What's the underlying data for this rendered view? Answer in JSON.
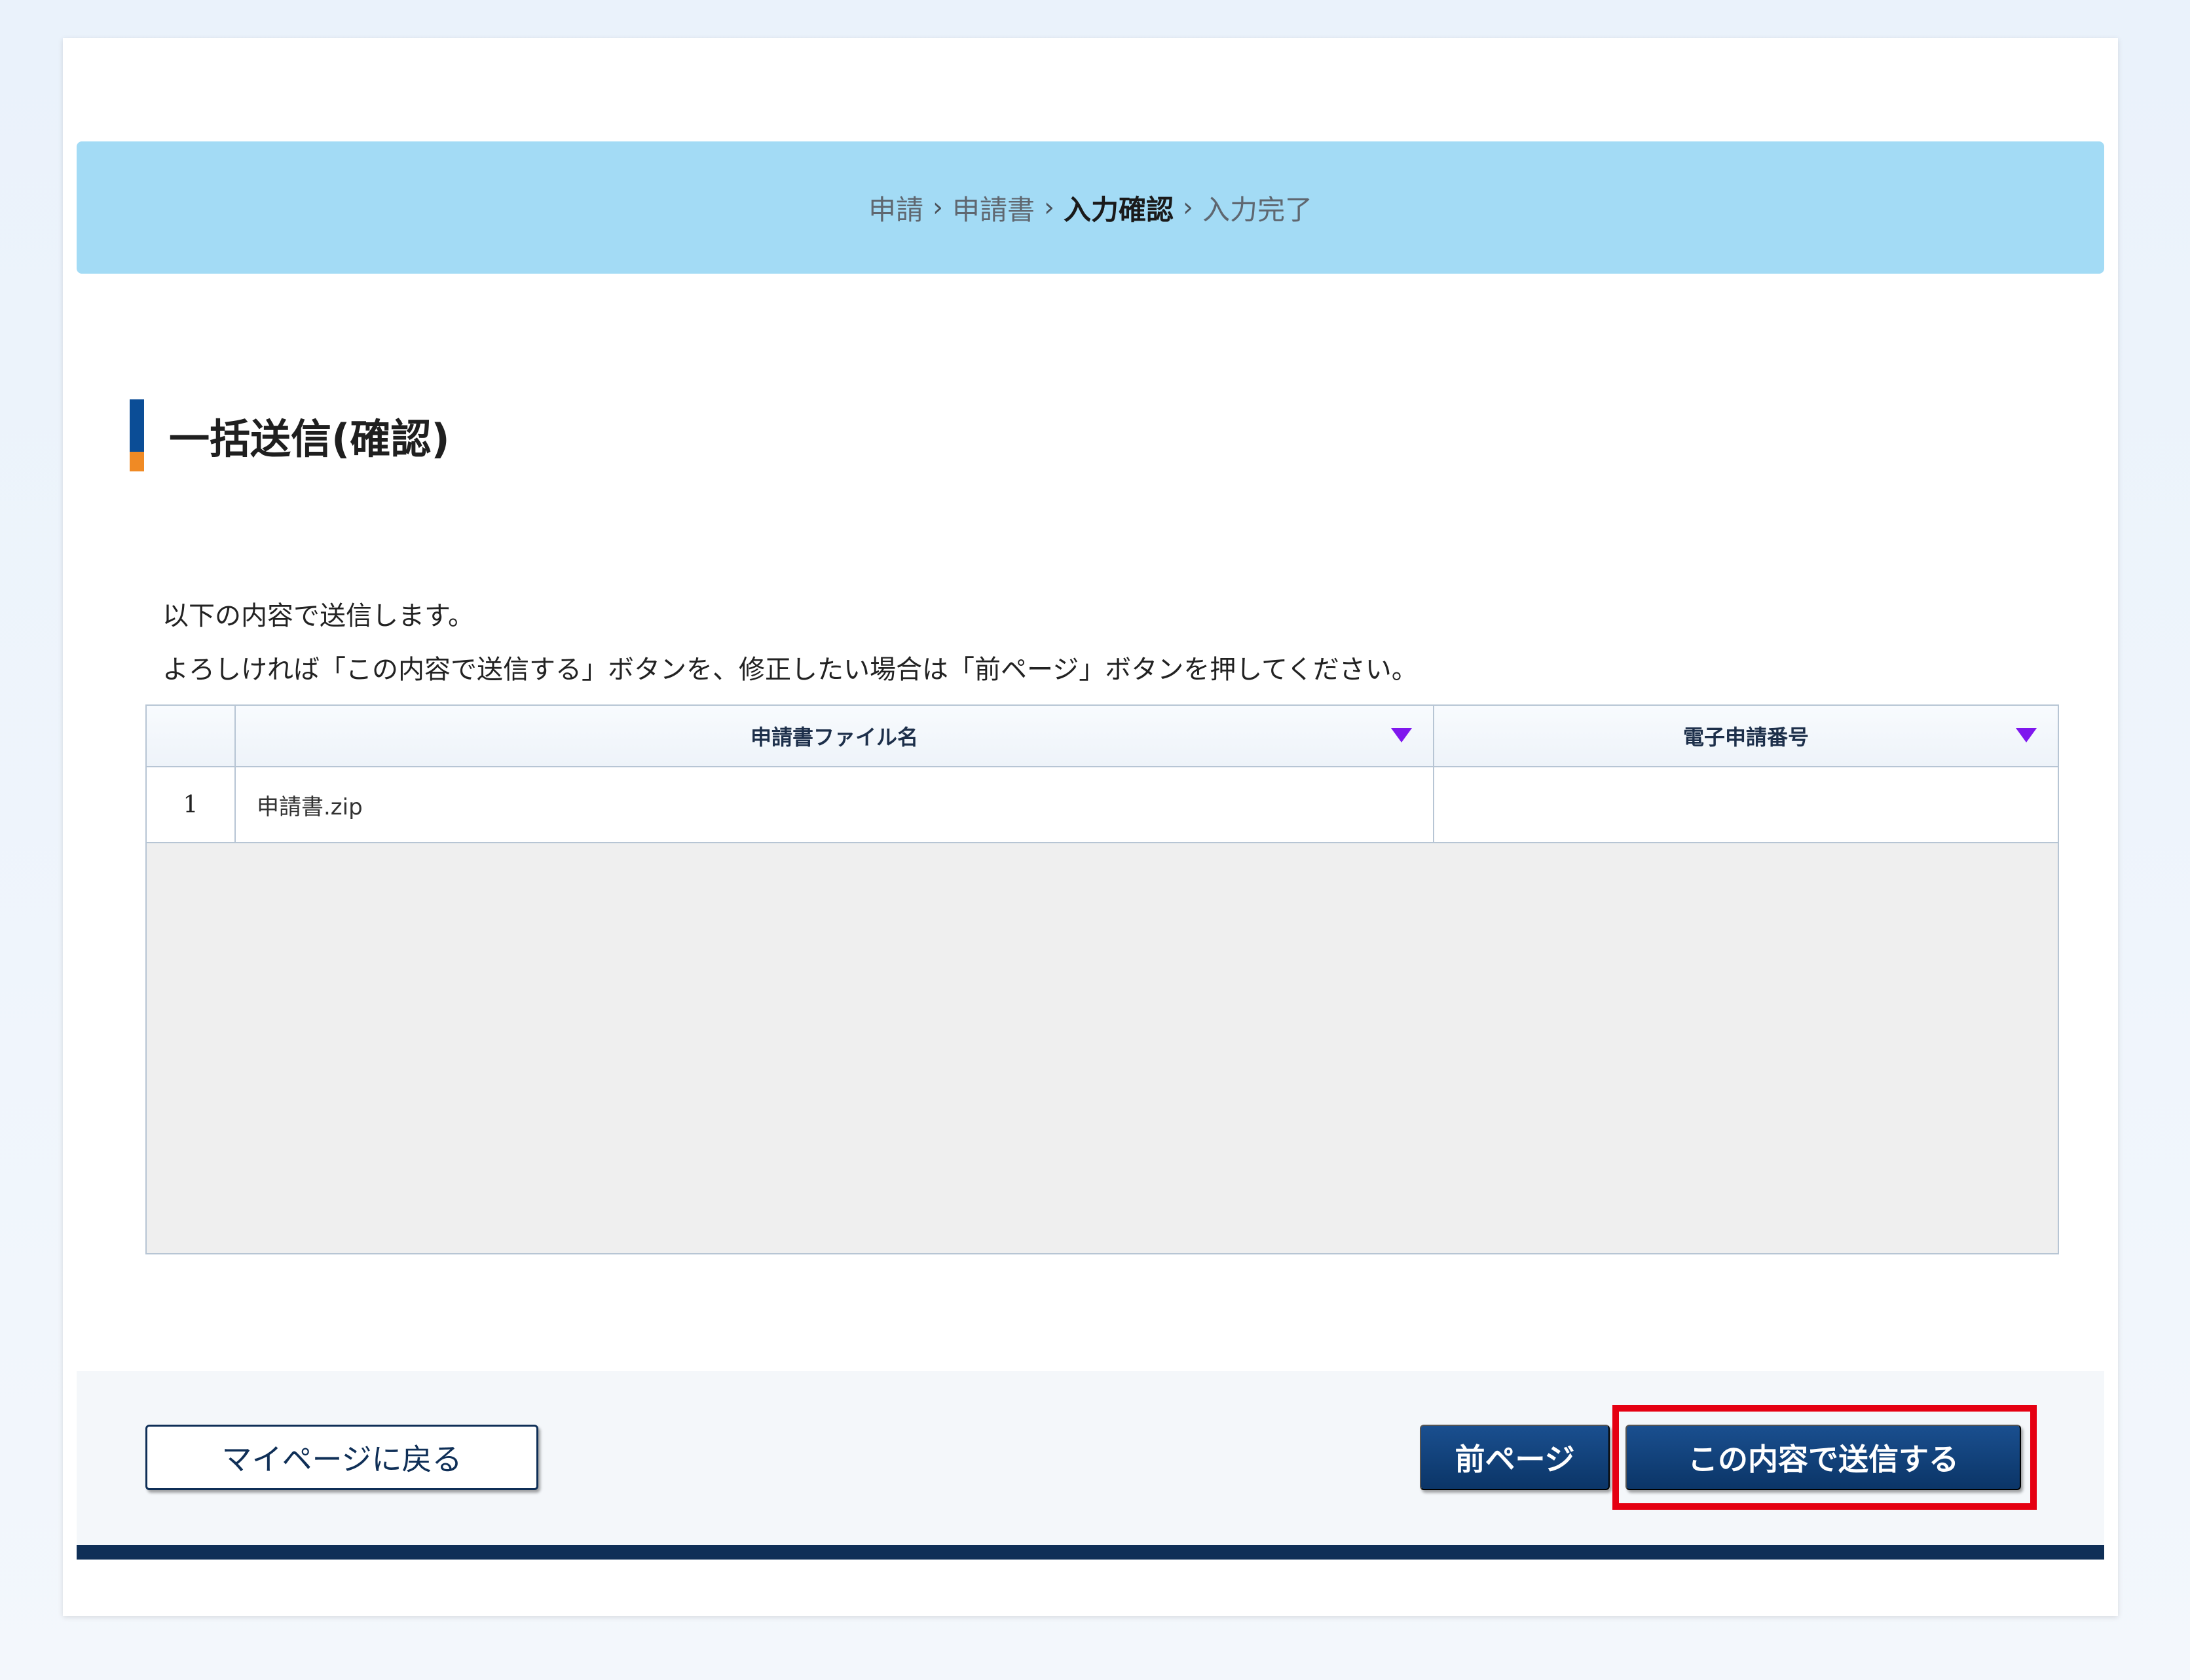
{
  "breadcrumb": {
    "items": [
      {
        "label": "申請",
        "current": false
      },
      {
        "label": "申請書",
        "current": false
      },
      {
        "label": "入力確認",
        "current": true
      },
      {
        "label": "入力完了",
        "current": false
      }
    ],
    "separator": "›"
  },
  "page": {
    "title": "一括送信(確認)",
    "instructions": [
      "以下の内容で送信します。",
      "よろしければ「この内容で送信する」ボタンを、修正したい場合は「前ページ」ボタンを押してください。"
    ]
  },
  "table": {
    "columns": [
      "",
      "申請書ファイル名",
      "電子申請番号"
    ],
    "rows": [
      {
        "num": "1",
        "file_name": "申請書.zip",
        "app_number": ""
      }
    ]
  },
  "footer": {
    "back_label": "マイページに戻る",
    "prev_label": "前ページ",
    "send_label": "この内容で送信する"
  },
  "colors": {
    "banner": "#a3dbf5",
    "primary": "#0b3567",
    "accent_orange": "#f08a24",
    "accent_blue": "#0b4d96",
    "sort_icon": "#7f17ee",
    "highlight": "#e50012"
  },
  "icons": {
    "sort": "triangle-down-icon",
    "breadcrumb_separator": "chevron-right-icon"
  }
}
